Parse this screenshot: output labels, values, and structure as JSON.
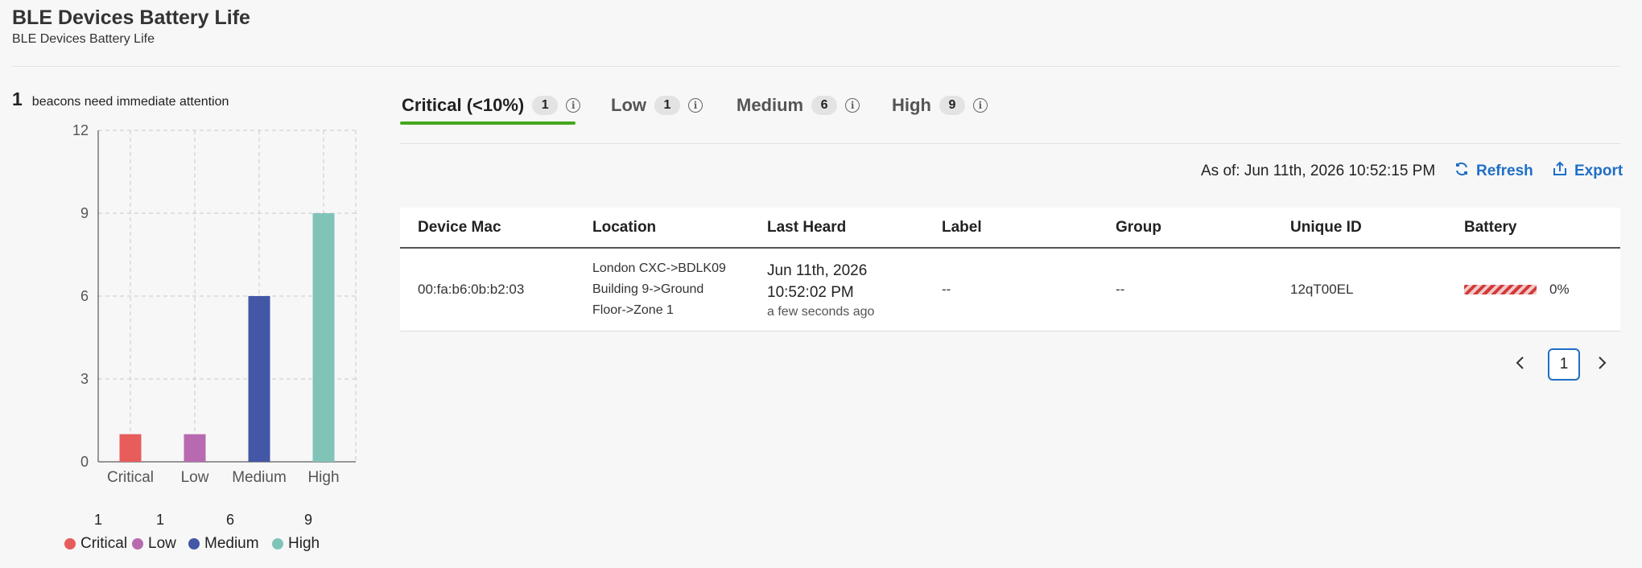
{
  "header": {
    "title": "BLE Devices Battery Life",
    "subtitle": "BLE Devices Battery Life"
  },
  "summary": {
    "count": "1",
    "text": "beacons need immediate attention"
  },
  "chart_data": {
    "type": "bar",
    "categories": [
      "Critical",
      "Low",
      "Medium",
      "High"
    ],
    "values": [
      1,
      1,
      6,
      9
    ],
    "colors": [
      "#e85c5c",
      "#b86ab0",
      "#4357a6",
      "#80c4b8"
    ],
    "ylim": [
      0,
      12
    ],
    "yticks": [
      0,
      3,
      6,
      9,
      12
    ],
    "grid": true,
    "legend_placement": "bottom"
  },
  "legend": {
    "items": [
      {
        "count": "1",
        "label": "Critical",
        "color": "#e85c5c"
      },
      {
        "count": "1",
        "label": "Low",
        "color": "#b86ab0"
      },
      {
        "count": "6",
        "label": "Medium",
        "color": "#4357a6"
      },
      {
        "count": "9",
        "label": "High",
        "color": "#80c4b8"
      }
    ]
  },
  "tabs": [
    {
      "label": "Critical (<10%)",
      "count": "1",
      "active": true
    },
    {
      "label": "Low",
      "count": "1",
      "active": false
    },
    {
      "label": "Medium",
      "count": "6",
      "active": false
    },
    {
      "label": "High",
      "count": "9",
      "active": false
    }
  ],
  "toolbar": {
    "as_of": "As of: Jun 11th, 2026 10:52:15 PM",
    "refresh_label": "Refresh",
    "export_label": "Export",
    "accent_color": "#1f6fc5"
  },
  "table": {
    "columns": [
      "Device Mac",
      "Location",
      "Last Heard",
      "Label",
      "Group",
      "Unique ID",
      "Battery"
    ],
    "rows": [
      {
        "mac": "00:fa:b6:0b:b2:03",
        "location": [
          "London CXC->BDLK09",
          "Building 9->Ground",
          "Floor->Zone 1"
        ],
        "last_heard_date": "Jun 11th, 2026",
        "last_heard_time": "10:52:02 PM",
        "last_heard_relative": "a few seconds ago",
        "label": "--",
        "group": "--",
        "unique_id": "12qT00EL",
        "battery": "0%",
        "battery_fraction": 0
      }
    ]
  },
  "pagination": {
    "current": "1",
    "prev_icon": "chevron-left-icon",
    "next_icon": "chevron-right-icon"
  }
}
